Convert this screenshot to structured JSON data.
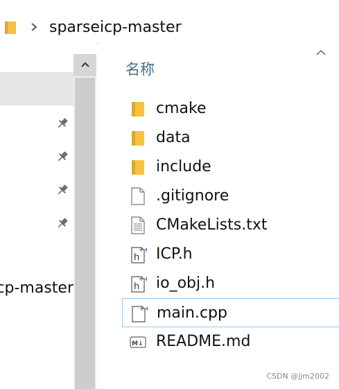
{
  "address_bar": {
    "path_segment": "sparseicp-master"
  },
  "content": {
    "column_header": "名称",
    "files": [
      {
        "name": "cmake",
        "type": "folder"
      },
      {
        "name": "data",
        "type": "folder"
      },
      {
        "name": "include",
        "type": "folder"
      },
      {
        "name": ".gitignore",
        "type": "file"
      },
      {
        "name": "CMakeLists.txt",
        "type": "text"
      },
      {
        "name": "ICP.h",
        "type": "header"
      },
      {
        "name": "io_obj.h",
        "type": "header"
      },
      {
        "name": "main.cpp",
        "type": "cpp",
        "selected": true
      },
      {
        "name": "README.md",
        "type": "markdown"
      }
    ]
  },
  "nav": {
    "truncated_item": "sparseicp-master"
  },
  "watermark": "CSDN @jjm2002",
  "colors": {
    "folder": "#f5c242",
    "selection_border": "#99c9ef",
    "nav_selected_bg": "#e5e5e5",
    "header_text": "#4a6c8c"
  }
}
